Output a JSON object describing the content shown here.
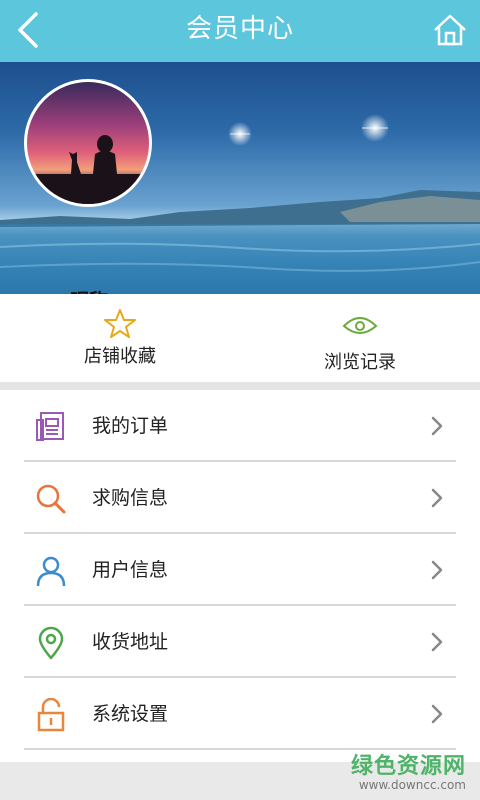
{
  "header": {
    "title": "会员中心"
  },
  "profile": {
    "nickname": "昵称"
  },
  "quick_actions": [
    {
      "label": "店铺收藏",
      "icon": "star-icon",
      "color": "#e8a81a"
    },
    {
      "label": "浏览记录",
      "icon": "eye-icon",
      "color": "#6aaa3a"
    }
  ],
  "menu": [
    {
      "label": "我的订单",
      "icon": "order-document-icon",
      "color": "#9b59b6"
    },
    {
      "label": "求购信息",
      "icon": "search-icon",
      "color": "#e8743b"
    },
    {
      "label": "用户信息",
      "icon": "user-icon",
      "color": "#3a8ccf"
    },
    {
      "label": "收货地址",
      "icon": "location-pin-icon",
      "color": "#4fa64a"
    },
    {
      "label": "系统设置",
      "icon": "lock-icon",
      "color": "#e8873b"
    }
  ],
  "watermark": {
    "text": "绿色资源网",
    "url": "www.downcc.com"
  }
}
